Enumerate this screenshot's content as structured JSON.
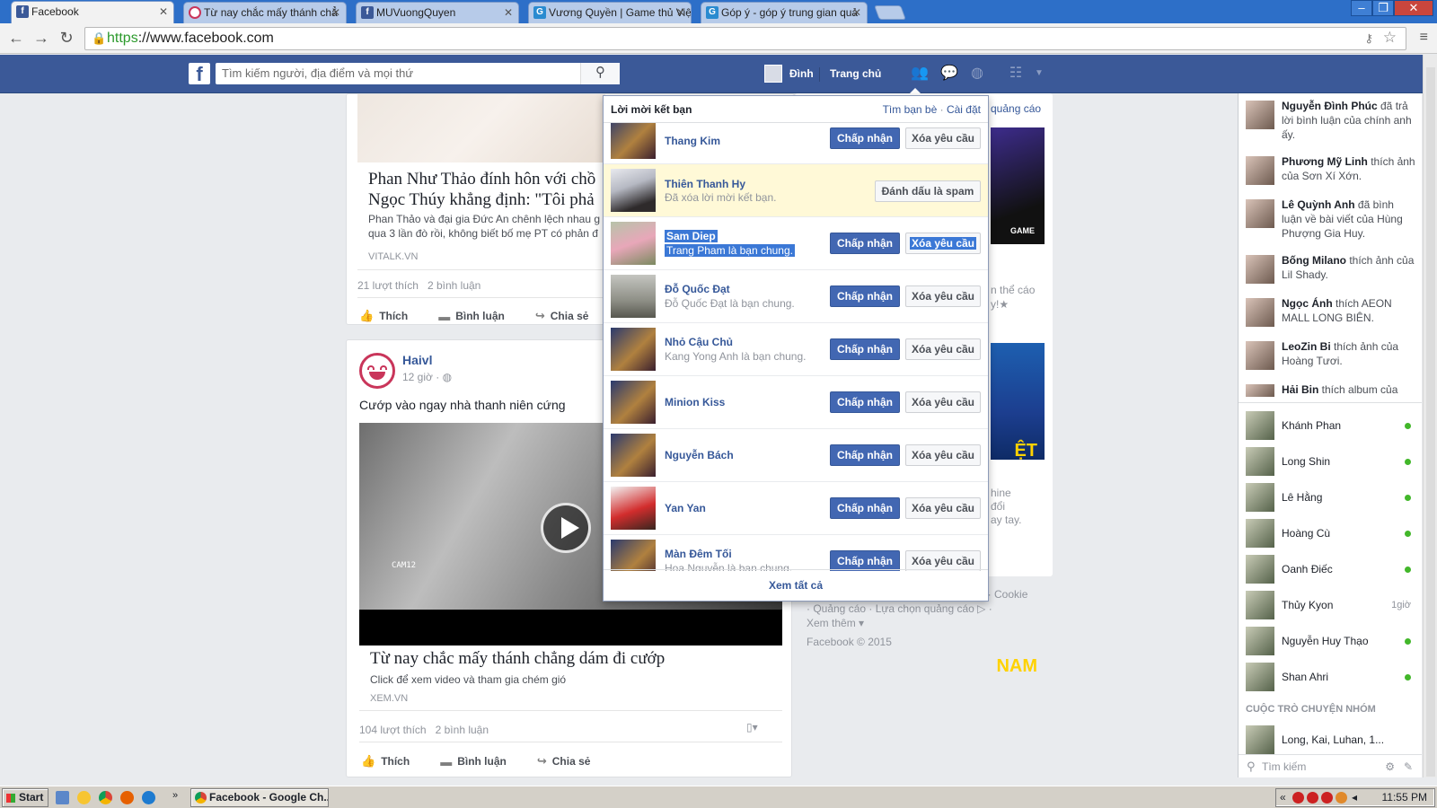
{
  "browser": {
    "tabs": [
      {
        "label": "Facebook",
        "icon": "facebook-icon",
        "active": true
      },
      {
        "label": "Từ nay chắc mấy thánh chẳ",
        "icon": "haivl-icon",
        "active": false
      },
      {
        "label": "MUVuongQuyen",
        "icon": "facebook-icon",
        "active": false
      },
      {
        "label": "Vương Quyền | Game thủ Việ",
        "icon": "g-icon",
        "active": false
      },
      {
        "label": "Góp ý - góp ý trung gian quả",
        "icon": "g-icon",
        "active": false
      }
    ],
    "url_scheme": "https",
    "url_rest": "://www.facebook.com"
  },
  "fb": {
    "search_placeholder": "Tìm kiếm người, địa điểm và mọi thứ",
    "user_name": "Đình",
    "home_label": "Trang chủ"
  },
  "feed": {
    "post1": {
      "headline_line1": "Phan Như Thảo đính hôn với chồ",
      "headline_line2": "Ngọc Thúy khẳng định: \"Tôi phả",
      "description": "Phan Thảo và đại gia Đức An chênh lệch nhau g qua 3 lần đò rồi, không biết bố mẹ PT có phản đ",
      "domain": "VITALK.VN",
      "likes": "21 lượt thích",
      "comments": "2 bình luận"
    },
    "post2": {
      "poster": "Haivl",
      "time": "12 giờ",
      "text": "Cướp vào ngay nhà thanh niên cứng",
      "video_overlay": "CAM12",
      "headline": "Từ nay chắc mấy thánh chẳng dám đi cướp",
      "description": "Click để xem video và tham gia chém gió",
      "domain": "XEM.VN",
      "likes": "104 lượt thích",
      "comments": "2 bình luận"
    },
    "actions": {
      "like": "Thích",
      "comment": "Bình luận",
      "share": "Chia sẻ"
    }
  },
  "right_column": {
    "ad_label": "quảng cáo",
    "snippet1_line1": "n thể cáo",
    "snippet1_line2": "y!★",
    "snippet2_line1": "hine",
    "snippet2_line2": "đổi",
    "snippet2_line3": "ay tay.",
    "game_logo": "GAME",
    "viet_nam": "ỆT NAM",
    "footer_line1": "ận · Cookie",
    "footer_line2": "· Quảng cáo · Lựa chọn quảng cáo ▷ ·",
    "footer_line3": "Xem thêm ▾",
    "copyright": "Facebook © 2015"
  },
  "friend_requests": {
    "title": "Lời mời kết bạn",
    "find_friends": "Tìm bạn bè",
    "settings": "Cài đặt",
    "accept_label": "Chấp nhận",
    "delete_label": "Xóa yêu cầu",
    "spam_label": "Đánh dấu là spam",
    "see_all": "Xem tất cả",
    "items": [
      {
        "name": "Thang Kim",
        "sub": ""
      },
      {
        "name": "Thiên Thanh Hy",
        "sub": "Đã xóa lời mời kết bạn."
      },
      {
        "name": "Sam Diep",
        "sub": "Trang Pham là bạn chung."
      },
      {
        "name": "Đỗ Quốc Đạt",
        "sub": "Đỗ Quốc Đạt là bạn chung."
      },
      {
        "name": "Nhỏ Cậu Chủ",
        "sub": "Kang Yong Anh là bạn chung."
      },
      {
        "name": "Minion Kiss",
        "sub": ""
      },
      {
        "name": "Nguyễn Bách",
        "sub": ""
      },
      {
        "name": "Yan Yan",
        "sub": ""
      },
      {
        "name": "Màn Đêm Tối",
        "sub": "Hoa Nguyễn là bạn chung."
      }
    ]
  },
  "ticker": [
    {
      "name": "Nguyễn Đình Phúc",
      "text": " đã trả lời bình luận của chính anh ấy."
    },
    {
      "name": "Phương Mỹ Linh",
      "text": " thích ảnh của Sơn Xí Xớn."
    },
    {
      "name": "Lê Quỳnh Anh",
      "text": " đã bình luận về bài viết của Hùng Phượng Gia Huy."
    },
    {
      "name": "Bống Milano",
      "text": " thích ảnh của Lil Shady."
    },
    {
      "name": "Ngọc Ánh",
      "text": " thích AEON MALL LONG BIÊN."
    },
    {
      "name": "LeoZin Bi",
      "text": " thích ảnh của Hoàng Tươi."
    },
    {
      "name": "Hải Bin",
      "text": " thích album của"
    }
  ],
  "chat": {
    "contacts": [
      {
        "name": "Khánh Phan",
        "status": "online"
      },
      {
        "name": "Long Shin",
        "status": "online"
      },
      {
        "name": "Lê Hằng",
        "status": "online"
      },
      {
        "name": "Hoàng Cù",
        "status": "online"
      },
      {
        "name": "Oanh Điếc",
        "status": "online"
      },
      {
        "name": "Thủy Kyon",
        "status": "1giờ"
      },
      {
        "name": "Nguyễn Huy Thạo",
        "status": "online"
      },
      {
        "name": "Shan Ahri",
        "status": "online"
      }
    ],
    "groups_title": "CUỘC TRÒ CHUYỆN NHÓM",
    "group_item": "Long, Kai, Luhan, 1...",
    "search_placeholder": "Tìm kiếm"
  },
  "taskbar": {
    "start": "Start",
    "task": "Facebook - Google Ch...",
    "clock": "11:55 PM"
  }
}
